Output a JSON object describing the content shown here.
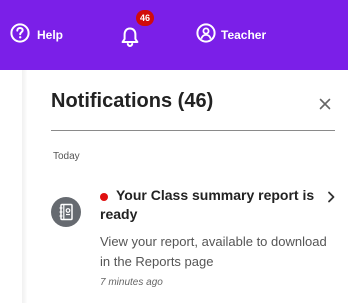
{
  "header": {
    "help_label": "Help",
    "notifications_badge": "46",
    "teacher_label": "Teacher",
    "background_color": "#7b1fe8",
    "icons": [
      "help-circle-icon",
      "bell-icon",
      "user-circle-icon"
    ]
  },
  "panel": {
    "title": "Notifications (46)",
    "close_icon": "close-icon",
    "section_label": "Today",
    "notifications": [
      {
        "icon": "report-book-icon",
        "unread": true,
        "unread_color": "#e01010",
        "title": "Your Class summary report is ready",
        "body": "View your report, available to download in the Reports page",
        "time": "7 minutes ago",
        "chevron_icon": "chevron-right-icon"
      }
    ]
  }
}
